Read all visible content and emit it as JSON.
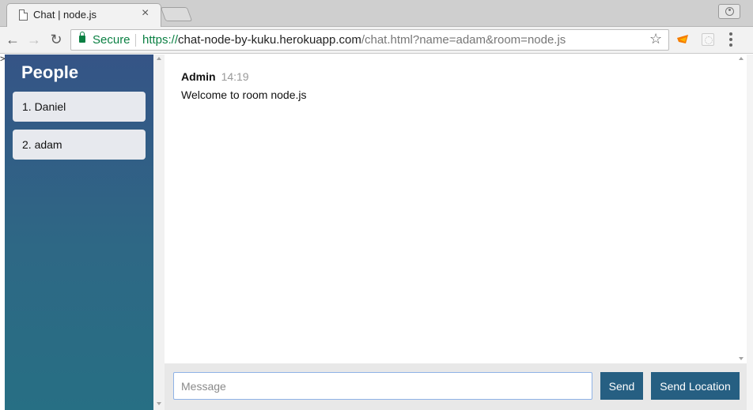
{
  "browser": {
    "tab_title": "Chat | node.js",
    "close_glyph": "×",
    "secure_label": "Secure",
    "url_scheme": "https://",
    "url_host": "chat-node-by-kuku.herokuapp.com",
    "url_path": "/chat.html?name=adam&room=node.js",
    "back_glyph": "←",
    "forward_glyph": "→",
    "reload_glyph": "↻",
    "star_glyph": "☆"
  },
  "page": {
    "edge_mark": ">"
  },
  "sidebar": {
    "title": "People",
    "people": [
      {
        "label": "1. Daniel"
      },
      {
        "label": "2. adam"
      }
    ]
  },
  "messages": [
    {
      "author": "Admin",
      "time": "14:19",
      "text": "Welcome to room node.js"
    }
  ],
  "composer": {
    "placeholder": "Message",
    "send_label": "Send",
    "send_location_label": "Send Location"
  },
  "colors": {
    "accent": "#265f82",
    "sidebar_top": "#355486",
    "sidebar_bottom": "#276f84",
    "secure_green": "#0b8043"
  }
}
